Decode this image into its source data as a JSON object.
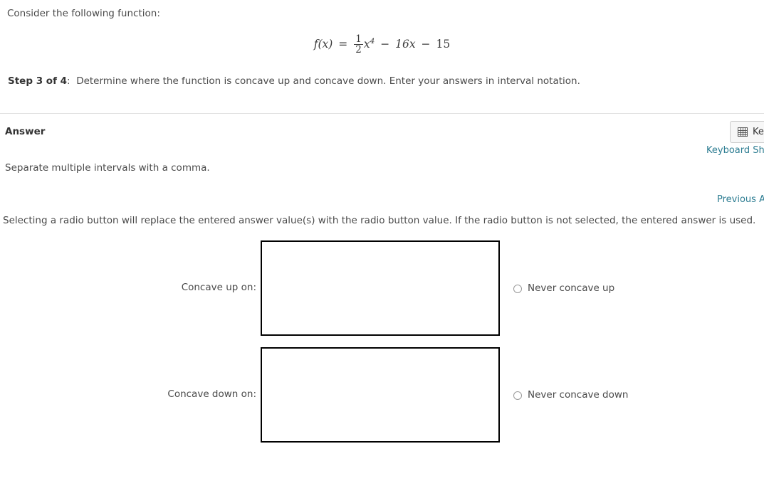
{
  "problem": {
    "prompt": "Consider the following function:",
    "formula": {
      "lhs": "f(x)",
      "equals": "=",
      "fraction_numerator": "1",
      "fraction_denominator": "2",
      "variable": "x",
      "exponent": "4",
      "term2_op": "−",
      "term2": "16x",
      "term3_op": "−",
      "term3": "15"
    },
    "step_label": "Step 3 of 4",
    "step_separator": ":",
    "step_text": "Determine where the function is concave up and concave down. Enter your answers in interval notation."
  },
  "answer_section": {
    "title": "Answer",
    "keypad_button_label": "Keypad",
    "keypad_icon": "grid-keypad-icon",
    "keyboard_shortcuts_link": "Keyboard Shortcuts",
    "hint": "Separate multiple intervals with a comma.",
    "previous_answers_link": "Previous Answers",
    "radio_note": "Selecting a radio button will replace the entered answer value(s) with the radio button value. If the radio button is not selected, the entered answer is used."
  },
  "rows": [
    {
      "label": "Concave up on:",
      "input_value": "",
      "input_placeholder": "",
      "radio_label": "Never concave up",
      "radio_selected": false
    },
    {
      "label": "Concave down on:",
      "input_value": "",
      "input_placeholder": "",
      "radio_label": "Never concave down",
      "radio_selected": false
    }
  ],
  "colors": {
    "link": "#2d7d92",
    "text": "#4a4a4a",
    "box_border": "#000000",
    "divider": "#e2e2e2"
  }
}
